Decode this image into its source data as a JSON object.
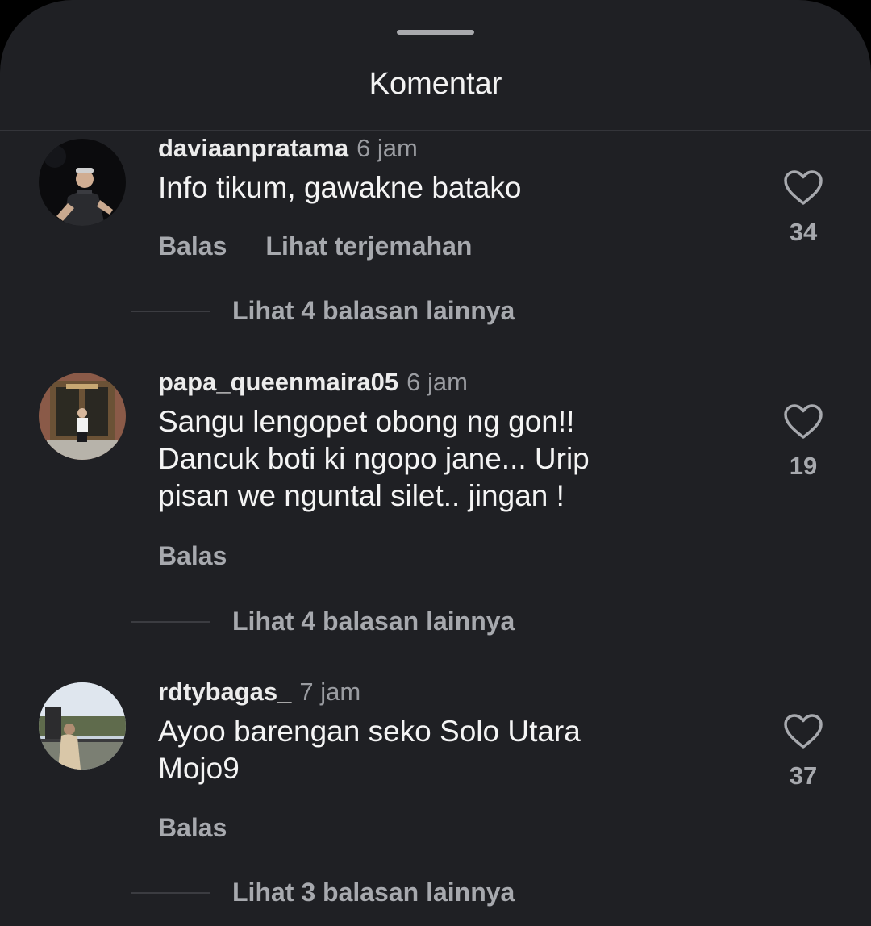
{
  "sheet": {
    "title": "Komentar"
  },
  "comments": [
    {
      "username": "daviaanpratama",
      "time": "6 jam",
      "text": "Info tikum, gawakne batako",
      "actions": [
        "Balas",
        "Lihat terjemahan"
      ],
      "likes": "34",
      "replies_label": "Lihat 4 balasan lainnya"
    },
    {
      "username": "papa_queenmaira05",
      "time": "6 jam",
      "text": "Sangu lengopet obong ng gon!!\nDancuk boti ki ngopo jane... Urip\npisan we nguntal silet.. jingan !",
      "actions": [
        "Balas"
      ],
      "likes": "19",
      "replies_label": "Lihat 4 balasan lainnya"
    },
    {
      "username": "rdtybagas_",
      "time": "7 jam",
      "text": "Ayoo barengan seko Solo Utara\nMojo9",
      "actions": [
        "Balas"
      ],
      "likes": "37",
      "replies_label": "Lihat 3 balasan lainnya"
    }
  ],
  "colors": {
    "background": "#1f2024",
    "text_primary": "#f4f4f4",
    "text_secondary": "#a7a9ae"
  }
}
